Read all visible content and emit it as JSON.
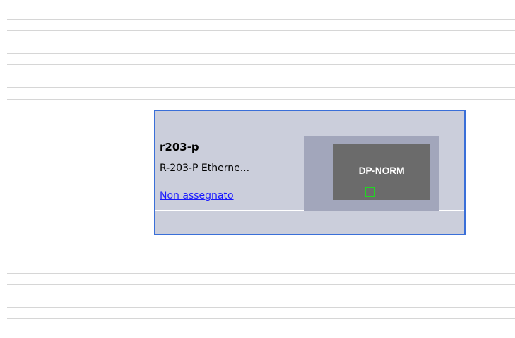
{
  "device": {
    "name": "r203-p",
    "type": "R-203-P  Etherne...",
    "assignment_link": "Non assegnato",
    "module": {
      "label": "DP-NORM",
      "port_icon": "network-port-icon"
    }
  },
  "colors": {
    "selection_border": "#3a6fd8",
    "device_body": "#cbcedb",
    "slot_area": "#a2a6bb",
    "module_body": "#6b6b6b",
    "port_outline": "#22d622",
    "link": "#1a1aff",
    "rail_line": "#d6d6d6"
  }
}
